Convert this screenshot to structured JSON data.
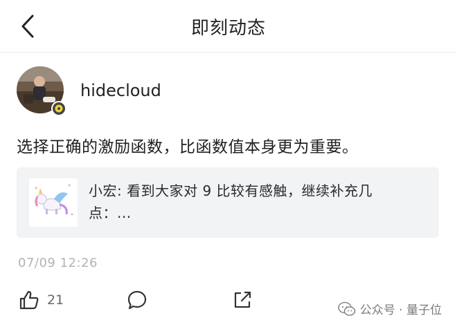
{
  "header": {
    "title": "即刻动态"
  },
  "author": {
    "name": "hidecloud"
  },
  "post": {
    "text": "选择正确的激励函数，比函数值本身更为重要。"
  },
  "quote": {
    "text": "小宏: 看到大家对 9 比较有感触，继续补充几点：..."
  },
  "meta": {
    "timestamp": "07/09 12:26"
  },
  "actions": {
    "like_count": "21"
  },
  "watermark": {
    "text": "公众号 · 量子位"
  },
  "icons": {
    "back": "chevron-left-icon",
    "like": "thumbs-up-icon",
    "comment": "speech-bubble-icon",
    "share": "share-out-icon",
    "badge": "gear-badge-icon",
    "wechat": "wechat-icon"
  }
}
